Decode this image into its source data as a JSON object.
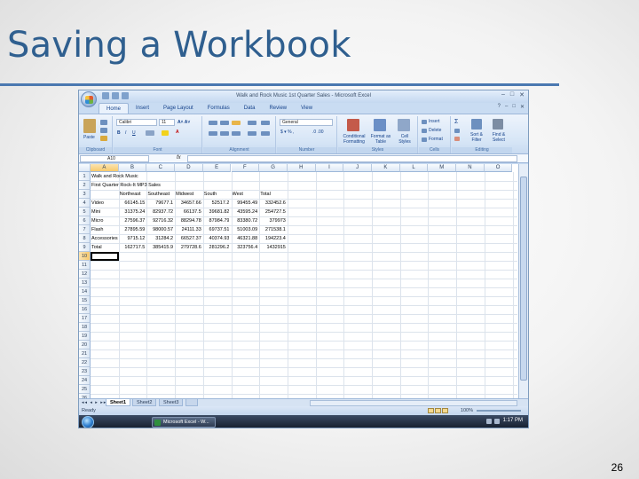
{
  "slide": {
    "title": "Saving a Workbook",
    "page_number": "26"
  },
  "window": {
    "title": "Walk and Rock Music 1st Quarter Sales - Microsoft Excel",
    "controls": [
      "–",
      "□",
      "✕"
    ]
  },
  "ribbon": {
    "tabs": [
      "Home",
      "Insert",
      "Page Layout",
      "Formulas",
      "Data",
      "Review",
      "View"
    ],
    "active_tab": "Home",
    "font_name": "Calibri",
    "font_size": "11",
    "number_format": "General",
    "groups": [
      "Clipboard",
      "Font",
      "Alignment",
      "Number",
      "Styles",
      "Cells",
      "Editing"
    ],
    "paste_label": "Paste",
    "conditional_label": "Conditional Formatting",
    "format_table_label": "Format as Table",
    "cell_styles_label": "Cell Styles",
    "insert_label": "Insert",
    "delete_label": "Delete",
    "format_label": "Format",
    "sort_label": "Sort & Filter",
    "find_label": "Find & Select"
  },
  "formula_bar": {
    "name_box": "A10",
    "fx": "fx",
    "value": ""
  },
  "grid": {
    "columns": [
      "A",
      "B",
      "C",
      "D",
      "E",
      "F",
      "G",
      "H",
      "I",
      "J",
      "K",
      "L",
      "M",
      "N",
      "O"
    ],
    "row_numbers": [
      "1",
      "2",
      "3",
      "4",
      "5",
      "6",
      "7",
      "8",
      "9",
      "10",
      "11",
      "12",
      "13",
      "14",
      "15",
      "16",
      "17",
      "18",
      "19",
      "20",
      "21",
      "22",
      "23",
      "24",
      "25",
      "26"
    ],
    "rows": [
      [
        "Walk and Rock Music",
        "",
        "",
        "",
        "",
        "",
        ""
      ],
      [
        "First Quarter Rock-It MP3 Sales",
        "",
        "",
        "",
        "",
        "",
        ""
      ],
      [
        "",
        "Northeast",
        "Southeast",
        "Midwest",
        "South",
        "West",
        "Total"
      ],
      [
        "Video",
        "66145.15",
        "79677.1",
        "34657.66",
        "52517.2",
        "99455.49",
        "332452.6"
      ],
      [
        "Mini",
        "31375.24",
        "82937.72",
        "66137.5",
        "39681.82",
        "43595.24",
        "254727.5"
      ],
      [
        "Micro",
        "27596.37",
        "92716.32",
        "88294.78",
        "87984.79",
        "83380.72",
        "379973"
      ],
      [
        "Flash",
        "27895.59",
        "98000.57",
        "24111.33",
        "69737.51",
        "51003.09",
        "271538.1"
      ],
      [
        "Accessories",
        "9715.12",
        "31284.2",
        "66527.37",
        "40374.93",
        "46321.88",
        "194223.4"
      ],
      [
        "Total",
        "162717.5",
        "385415.9",
        "279728.6",
        "281296.2",
        "323756.4",
        "1432915"
      ]
    ],
    "active_cell": "A10"
  },
  "sheets": [
    "Sheet1",
    "Sheet2",
    "Sheet3"
  ],
  "active_sheet": "Sheet1",
  "status": {
    "ready": "Ready",
    "zoom": "100%"
  },
  "taskbar": {
    "item": "Microsoft Excel - W...",
    "clock": "1:17 PM"
  }
}
